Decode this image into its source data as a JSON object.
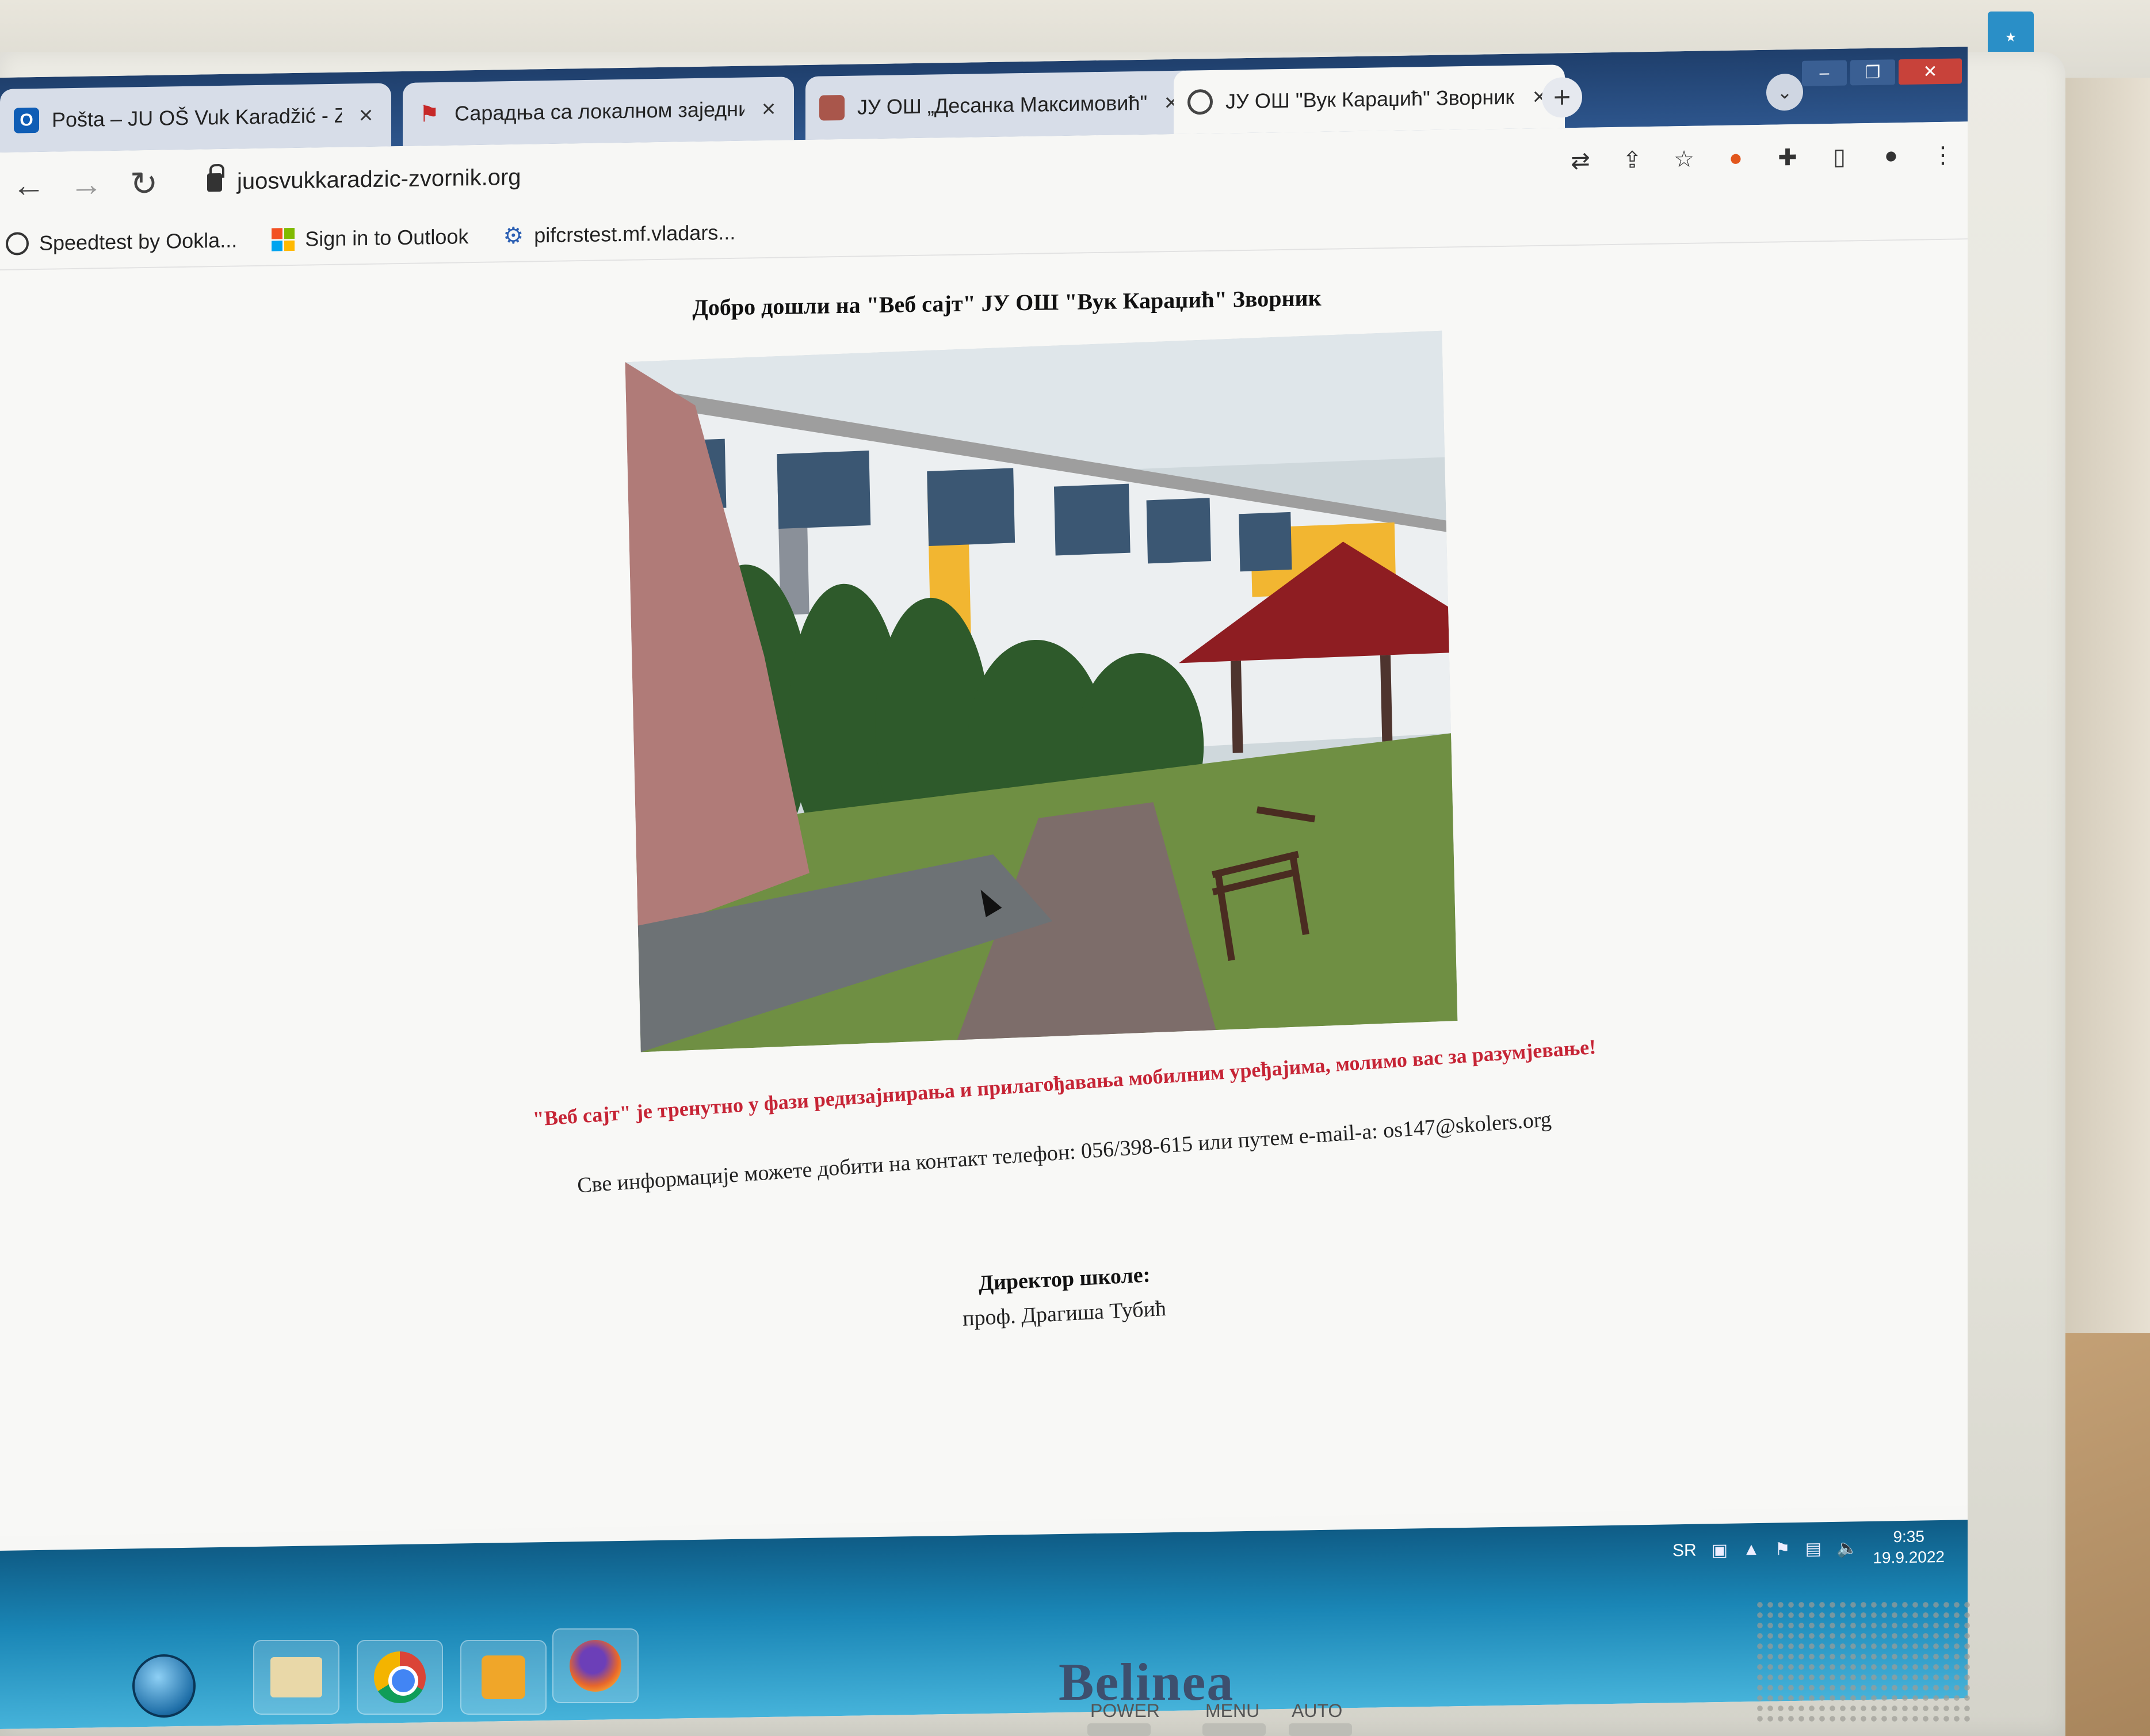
{
  "browser": {
    "tabs": [
      {
        "label": "Pošta – JU OŠ Vuk Karadžić - Zvo",
        "icon": "outlook-icon",
        "active": false
      },
      {
        "label": "Сарадња са локалном заједниц",
        "icon": "pin-icon",
        "active": false
      },
      {
        "label": "ЈУ ОШ „Десанка Максимовић\"",
        "icon": "image-favicon",
        "active": false
      },
      {
        "label": "ЈУ ОШ \"Вук Караџић\" Зворник",
        "icon": "globe-icon",
        "active": true
      }
    ],
    "tab_close_glyph": "×",
    "new_tab_glyph": "+",
    "url": "juosvukkaradzic-zvornik.org",
    "bookmarks": [
      {
        "label": "Speedtest by Ookla...",
        "icon": "speedtest-icon"
      },
      {
        "label": "Sign in to Outlook",
        "icon": "microsoft-icon"
      },
      {
        "label": "pifcrstest.mf.vladars...",
        "icon": "gear-icon"
      }
    ]
  },
  "page": {
    "title": "Добро дошли на \"Веб сајт\" ЈУ ОШ \"Вук Караџић\" Зворник",
    "notice": "\"Веб сајт\" је тренутно у фази редизајнирања и прилагођавања мобилним уређајима, молимо вас за разумјевање!",
    "contact": "Све информације можете добити на контакт телефон: 056/398-615 или путем e-mail-a: os147@skolers.org",
    "director_label": "Директор школе:",
    "director_name": "проф. Драгиша Тубић"
  },
  "taskbar": {
    "language": "SR",
    "time": "9:35",
    "date": "19.9.2022"
  },
  "monitor": {
    "brand": "Belinea",
    "buttons": [
      "POWER",
      "MENU",
      "AUTO"
    ]
  },
  "colors": {
    "notice": "#c62435",
    "tabstrip": "#2d558c",
    "taskbar": "#1a86b6"
  }
}
